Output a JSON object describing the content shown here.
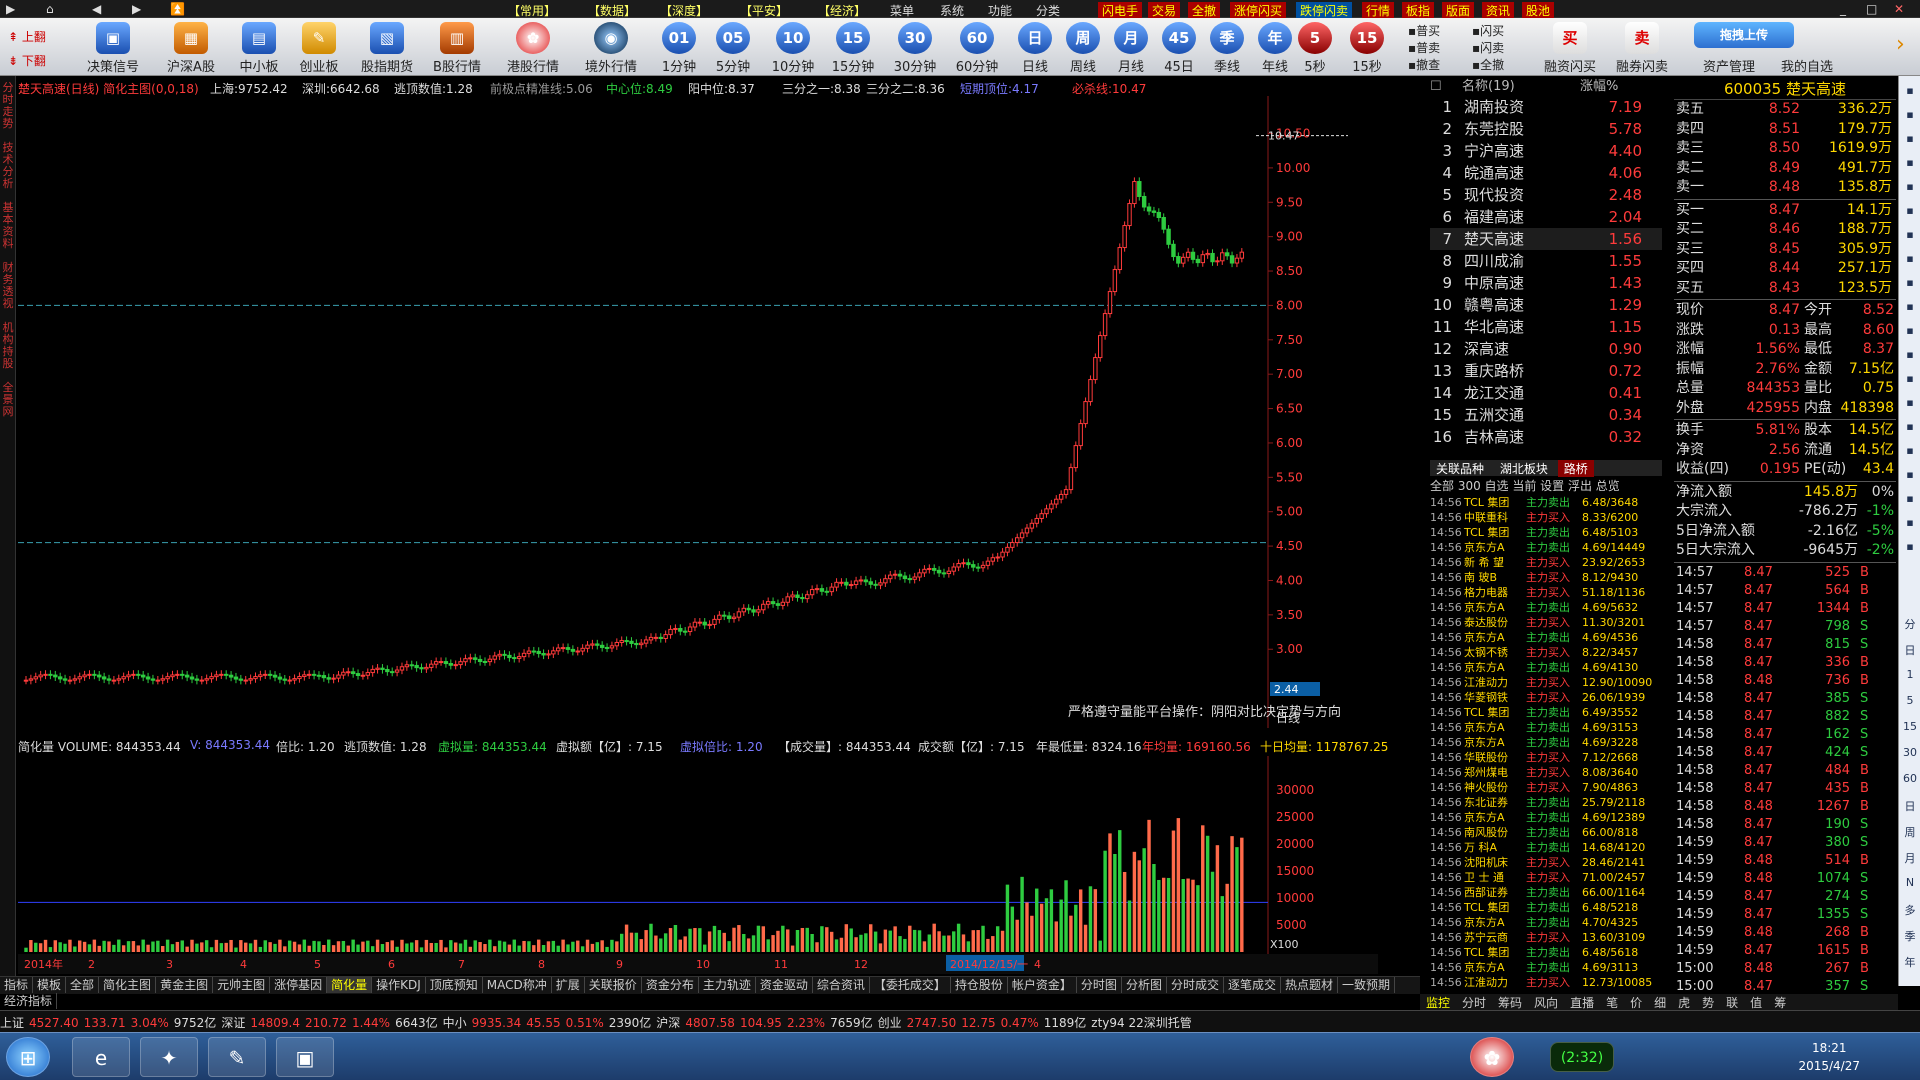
{
  "menu": {
    "items": [
      "【常用】",
      "【数据】",
      "【深度】",
      "【平安】",
      "【经济】",
      "菜单",
      "系统",
      "功能",
      "分类"
    ],
    "right": [
      "闪电手",
      "交易",
      "全撤",
      "涨停闪买",
      "跌停闪卖",
      "行情",
      "板指",
      "版面",
      "资讯",
      "股池"
    ]
  },
  "toolbar": {
    "pager": [
      "上翻",
      "下翻"
    ],
    "buttons": [
      "决策信号",
      "沪深A股",
      "中小板",
      "创业板",
      "股指期货",
      "B股行情",
      "港股行情",
      "境外行情",
      "1分钟",
      "5分钟",
      "10分钟",
      "15分钟",
      "30分钟",
      "60分钟",
      "日线",
      "周线",
      "月线",
      "45日",
      "季线",
      "年线",
      "5秒",
      "15秒"
    ],
    "btn_icons": [
      "01",
      "05",
      "10",
      "15",
      "30",
      "60",
      "日",
      "周",
      "月",
      "45",
      "季",
      "年",
      "5",
      "15"
    ],
    "quick": [
      "普买",
      "普卖",
      "撤查",
      "闪买",
      "闪卖",
      "全撤"
    ],
    "right": [
      "融资闪买",
      "融券闪卖",
      "资产管理",
      "我的自选"
    ],
    "upload": "拖拽上传"
  },
  "leftnav": [
    "分时走势",
    "技术分析",
    "基本资料",
    "财务透视",
    "机构持股",
    "全景网"
  ],
  "chart": {
    "title": "楚天高速(日线) 简化主图(0,0,18)",
    "sh": "上海:9752.42",
    "sz": "深圳:6642.68",
    "escape": "逃顶数值:1.28",
    "seq": "前极点精准线:5.06",
    "center": "中心位:8.49",
    "sunmid": "阳中位:8.37",
    "third1": "三分之一:8.38",
    "third2": "三分之二:8.36",
    "short": "短期顶位:4.17",
    "kill": "必杀线:10.47",
    "annotation": "严格遵守量能平台操作：阴阳对比决定势与方向",
    "label_ticks": [
      "10.50",
      "10.00",
      "9.50",
      "9.00",
      "8.50",
      "8.00",
      "7.50",
      "7.00",
      "6.50",
      "6.00",
      "5.50",
      "5.00",
      "4.50",
      "4.00",
      "3.50",
      "3.00"
    ],
    "price_box": "2.44",
    "high_label": "10.47",
    "period": "日线"
  },
  "volume": {
    "info": [
      "简化量 VOLUME: 844353.44",
      "V: 844353.44",
      "倍比: 1.20",
      "逃顶数值: 1.28",
      "虚拟量: 844353.44",
      "虚拟额【亿】: 7.15",
      "虚拟倍比: 1.20",
      "【成交量】: 844353.44",
      "成交额【亿】: 7.15",
      "年最低量: 8324.16",
      "年均量: 169160.56",
      "十日均量: 1178767.25"
    ],
    "ticks": [
      "30000",
      "25000",
      "20000",
      "15000",
      "10000",
      "5000"
    ],
    "unit": "X100"
  },
  "dates": [
    "2014年",
    "2",
    "3",
    "4",
    "5",
    "6",
    "7",
    "8",
    "9",
    "10",
    "11",
    "12",
    "2014/12/15/一",
    "4"
  ],
  "tabs": [
    "指标",
    "模板",
    "全部",
    "简化主图",
    "黄金主图",
    "元帅主图",
    "涨停基因",
    "简化量",
    "操作KDJ",
    "顶底预知",
    "MACD称冲",
    "扩展",
    "关联报价",
    "资金分布",
    "主力轨迹",
    "资金驱动",
    "综合资讯",
    "【委托成交】",
    "持仓股份",
    "帐户资金】",
    "分时图",
    "分析图",
    "分时成交",
    "逐笔成交",
    "热点题材",
    "一致预期",
    "经济指标"
  ],
  "status": {
    "items": [
      [
        "上证",
        ""
      ],
      [
        "4527.40",
        "u"
      ],
      [
        "133.71",
        "u"
      ],
      [
        "3.04%",
        "u"
      ],
      [
        "9752亿",
        ""
      ],
      [
        "深证",
        ""
      ],
      [
        "14809.4",
        "u"
      ],
      [
        "210.72",
        "u"
      ],
      [
        "1.44%",
        "u"
      ],
      [
        "6643亿",
        ""
      ],
      [
        "中小",
        ""
      ],
      [
        "9935.34",
        "u"
      ],
      [
        "45.55",
        "u"
      ],
      [
        "0.51%",
        "u"
      ],
      [
        "2390亿",
        ""
      ],
      [
        "沪深",
        ""
      ],
      [
        "4807.58",
        "u"
      ],
      [
        "104.95",
        "u"
      ],
      [
        "2.23%",
        "u"
      ],
      [
        "7659亿",
        ""
      ],
      [
        "创业",
        ""
      ],
      [
        "2747.50",
        "u"
      ],
      [
        "12.75",
        "u"
      ],
      [
        "0.47%",
        "u"
      ],
      [
        "1189亿",
        ""
      ],
      [
        "zty94 22深圳托管",
        ""
      ]
    ]
  },
  "ranklist": {
    "header": [
      "名称(19)",
      "涨幅%"
    ],
    "items": [
      [
        "1",
        "湖南投资",
        "7.19"
      ],
      [
        "2",
        "东莞控股",
        "5.78"
      ],
      [
        "3",
        "宁沪高速",
        "4.40"
      ],
      [
        "4",
        "皖通高速",
        "4.06"
      ],
      [
        "5",
        "现代投资",
        "2.48"
      ],
      [
        "6",
        "福建高速",
        "2.04"
      ],
      [
        "7",
        "楚天高速",
        "1.56"
      ],
      [
        "8",
        "四川成渝",
        "1.55"
      ],
      [
        "9",
        "中原高速",
        "1.43"
      ],
      [
        "10",
        "赣粤高速",
        "1.29"
      ],
      [
        "11",
        "华北高速",
        "1.15"
      ],
      [
        "12",
        "深高速",
        "0.90"
      ],
      [
        "13",
        "重庆路桥",
        "0.72"
      ],
      [
        "14",
        "龙江交通",
        "0.41"
      ],
      [
        "15",
        "五洲交通",
        "0.34"
      ],
      [
        "16",
        "吉林高速",
        "0.32"
      ]
    ],
    "tabs": [
      "关联品种",
      "湖北板块",
      "路桥"
    ]
  },
  "feed": {
    "header": "全部 300 自选 当前 设置 浮出 总览",
    "rows": [
      [
        "14:56",
        "TCL 集团",
        "主力卖出",
        "6.48/3648"
      ],
      [
        "14:56",
        "中联重科",
        "主力买入",
        "8.33/6200"
      ],
      [
        "14:56",
        "TCL 集团",
        "主力卖出",
        "6.48/5103"
      ],
      [
        "14:56",
        "京东方A",
        "主力卖出",
        "4.69/14449"
      ],
      [
        "14:56",
        "新 希 望",
        "主力买入",
        "23.92/2653"
      ],
      [
        "14:56",
        "南 玻B",
        "主力买入",
        "8.12/9430"
      ],
      [
        "14:56",
        "格力电器",
        "主力买入",
        "51.18/1136"
      ],
      [
        "14:56",
        "京东方A",
        "主力卖出",
        "4.69/5632"
      ],
      [
        "14:56",
        "泰达股份",
        "主力买入",
        "11.30/3201"
      ],
      [
        "14:56",
        "京东方A",
        "主力卖出",
        "4.69/4536"
      ],
      [
        "14:56",
        "太钢不锈",
        "主力买入",
        "8.22/3457"
      ],
      [
        "14:56",
        "京东方A",
        "主力卖出",
        "4.69/4130"
      ],
      [
        "14:56",
        "江淮动力",
        "主力买入",
        "12.90/10090"
      ],
      [
        "14:56",
        "华菱钢铁",
        "主力买入",
        "26.06/1939"
      ],
      [
        "14:56",
        "TCL 集团",
        "主力卖出",
        "6.49/3552"
      ],
      [
        "14:56",
        "京东方A",
        "主力卖出",
        "4.69/3153"
      ],
      [
        "14:56",
        "京东方A",
        "主力卖出",
        "4.69/3228"
      ],
      [
        "14:56",
        "华联股份",
        "主力买入",
        "7.12/2668"
      ],
      [
        "14:56",
        "郑州煤电",
        "主力买入",
        "8.08/3640"
      ],
      [
        "14:56",
        "神火股份",
        "主力买入",
        "7.90/4863"
      ],
      [
        "14:56",
        "东北证券",
        "主力卖出",
        "25.79/2118"
      ],
      [
        "14:56",
        "京东方A",
        "主力卖出",
        "4.69/12389"
      ],
      [
        "14:56",
        "南风股份",
        "主力卖出",
        "66.00/818"
      ],
      [
        "14:56",
        "万 科A",
        "主力卖出",
        "14.68/4120"
      ],
      [
        "14:56",
        "沈阳机床",
        "主力买入",
        "28.46/2141"
      ],
      [
        "14:56",
        "卫 士 通",
        "主力买入",
        "71.00/2457"
      ],
      [
        "14:56",
        "西部证券",
        "主力卖出",
        "66.00/1164"
      ],
      [
        "14:56",
        "TCL 集团",
        "主力卖出",
        "6.48/5218"
      ],
      [
        "14:56",
        "京东方A",
        "主力卖出",
        "4.70/4325"
      ],
      [
        "14:56",
        "苏宁云商",
        "主力买入",
        "13.60/3109"
      ],
      [
        "14:56",
        "TCL 集团",
        "主力卖出",
        "6.48/5618"
      ],
      [
        "14:56",
        "京东方A",
        "主力卖出",
        "4.69/3113"
      ],
      [
        "14:56",
        "江淮动力",
        "主力买入",
        "12.73/10085"
      ]
    ]
  },
  "quote": {
    "code": "600035",
    "name": "楚天高速",
    "asks": [
      [
        "卖五",
        "8.52",
        "336.2万"
      ],
      [
        "卖四",
        "8.51",
        "179.7万"
      ],
      [
        "卖三",
        "8.50",
        "1619.9万"
      ],
      [
        "卖二",
        "8.49",
        "491.7万"
      ],
      [
        "卖一",
        "8.48",
        "135.8万"
      ]
    ],
    "bids": [
      [
        "买一",
        "8.47",
        "14.1万"
      ],
      [
        "买二",
        "8.46",
        "188.7万"
      ],
      [
        "买三",
        "8.45",
        "305.9万"
      ],
      [
        "买四",
        "8.44",
        "257.1万"
      ],
      [
        "买五",
        "8.43",
        "123.5万"
      ]
    ],
    "stats": [
      [
        "现价",
        "8.47",
        "今开",
        "8.52"
      ],
      [
        "涨跌",
        "0.13",
        "最高",
        "8.60"
      ],
      [
        "涨幅",
        "1.56%",
        "最低",
        "8.37"
      ],
      [
        "振幅",
        "2.76%",
        "金额",
        "7.15亿"
      ],
      [
        "总量",
        "844353",
        "量比",
        "0.75"
      ],
      [
        "外盘",
        "425955",
        "内盘",
        "418398"
      ],
      [
        "换手",
        "5.81%",
        "股本",
        "14.5亿"
      ],
      [
        "净资",
        "2.56",
        "流通",
        "14.5亿"
      ],
      [
        "收益(四)",
        "0.195",
        "PE(动)",
        "43.4"
      ]
    ],
    "flows": [
      [
        "净流入额",
        "145.8万",
        "0%"
      ],
      [
        "大宗流入",
        "-786.2万",
        "-1%"
      ],
      [
        "5日净流入额",
        "-2.16亿",
        "-5%"
      ],
      [
        "5日大宗流入",
        "-9645万",
        "-2%"
      ]
    ],
    "trades": [
      [
        "14:57",
        "8.47",
        "525",
        "B"
      ],
      [
        "14:57",
        "8.47",
        "564",
        "B"
      ],
      [
        "14:57",
        "8.47",
        "1344",
        "B"
      ],
      [
        "14:57",
        "8.47",
        "798",
        "S"
      ],
      [
        "14:58",
        "8.47",
        "815",
        "S"
      ],
      [
        "14:58",
        "8.47",
        "336",
        "B"
      ],
      [
        "14:58",
        "8.48",
        "736",
        "B"
      ],
      [
        "14:58",
        "8.47",
        "385",
        "S"
      ],
      [
        "14:58",
        "8.47",
        "882",
        "S"
      ],
      [
        "14:58",
        "8.47",
        "162",
        "S"
      ],
      [
        "14:58",
        "8.47",
        "424",
        "S"
      ],
      [
        "14:58",
        "8.47",
        "484",
        "B"
      ],
      [
        "14:58",
        "8.47",
        "435",
        "B"
      ],
      [
        "14:58",
        "8.48",
        "1267",
        "B"
      ],
      [
        "14:58",
        "8.47",
        "190",
        "S"
      ],
      [
        "14:59",
        "8.47",
        "380",
        "S"
      ],
      [
        "14:59",
        "8.48",
        "514",
        "B"
      ],
      [
        "14:59",
        "8.48",
        "1074",
        "S"
      ],
      [
        "14:59",
        "8.47",
        "274",
        "S"
      ],
      [
        "14:59",
        "8.47",
        "1355",
        "S"
      ],
      [
        "14:59",
        "8.48",
        "268",
        "B"
      ],
      [
        "14:59",
        "8.47",
        "1615",
        "B"
      ],
      [
        "15:00",
        "8.48",
        "267",
        "B"
      ],
      [
        "15:00",
        "8.47",
        "357",
        "S"
      ]
    ]
  },
  "btmtabs": [
    "监控",
    "分时",
    "筹码",
    "风向",
    "直播",
    "笔",
    "价",
    "细",
    "虎",
    "势",
    "联",
    "值",
    "筹"
  ],
  "rightnav": [
    "分",
    "日",
    "1",
    "5",
    "15",
    "30",
    "60",
    "日",
    "周",
    "月",
    "N",
    "多",
    "季",
    "年"
  ],
  "taskbar": {
    "time": "18:21",
    "date": "2015/4/27",
    "ime": "(2:32)"
  },
  "colors": {
    "up": "#ff3b3b",
    "down": "#2ecc40",
    "line": "#ffd800",
    "bg": "#000000"
  }
}
